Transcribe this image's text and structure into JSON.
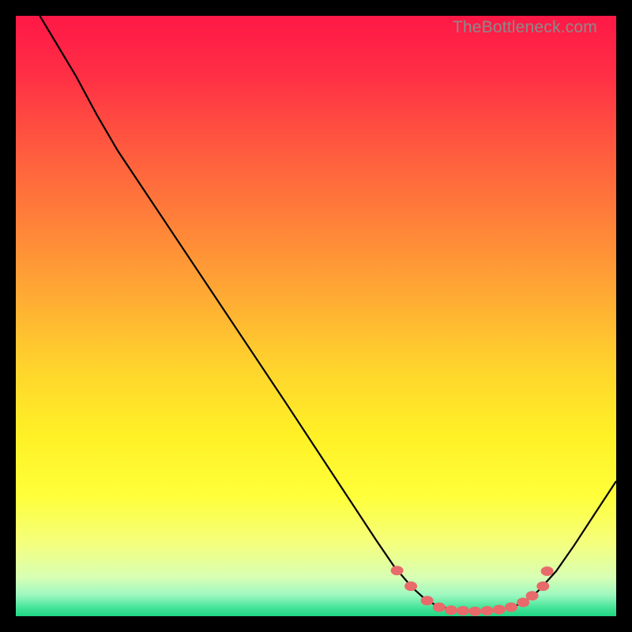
{
  "watermark": "TheBottleneck.com",
  "chart_data": {
    "type": "line",
    "title": "",
    "xlabel": "",
    "ylabel": "",
    "xlim": [
      0,
      100
    ],
    "ylim": [
      0,
      100
    ],
    "gradient_stops": [
      {
        "offset": 0.0,
        "color": "#ff1846"
      },
      {
        "offset": 0.1,
        "color": "#ff2f45"
      },
      {
        "offset": 0.22,
        "color": "#ff5a3f"
      },
      {
        "offset": 0.34,
        "color": "#ff8039"
      },
      {
        "offset": 0.46,
        "color": "#ffa834"
      },
      {
        "offset": 0.58,
        "color": "#ffd22d"
      },
      {
        "offset": 0.7,
        "color": "#fff126"
      },
      {
        "offset": 0.8,
        "color": "#ffff3a"
      },
      {
        "offset": 0.88,
        "color": "#f4ff7e"
      },
      {
        "offset": 0.935,
        "color": "#d8ffb4"
      },
      {
        "offset": 0.965,
        "color": "#9cf8c0"
      },
      {
        "offset": 0.985,
        "color": "#48e59a"
      },
      {
        "offset": 1.0,
        "color": "#1fd683"
      }
    ],
    "series": [
      {
        "name": "curve",
        "color": "#000000",
        "points": [
          {
            "x": 4.0,
            "y": 100.0
          },
          {
            "x": 7.0,
            "y": 95.0
          },
          {
            "x": 10.0,
            "y": 90.0
          },
          {
            "x": 13.5,
            "y": 83.5
          },
          {
            "x": 17.0,
            "y": 77.5
          },
          {
            "x": 25.0,
            "y": 65.5
          },
          {
            "x": 35.0,
            "y": 50.5
          },
          {
            "x": 45.0,
            "y": 35.5
          },
          {
            "x": 55.0,
            "y": 20.3
          },
          {
            "x": 60.0,
            "y": 12.7
          },
          {
            "x": 63.0,
            "y": 8.3
          },
          {
            "x": 66.0,
            "y": 4.8
          },
          {
            "x": 68.0,
            "y": 3.0
          },
          {
            "x": 70.0,
            "y": 1.8
          },
          {
            "x": 73.0,
            "y": 1.0
          },
          {
            "x": 77.0,
            "y": 0.8
          },
          {
            "x": 80.0,
            "y": 1.0
          },
          {
            "x": 83.0,
            "y": 1.6
          },
          {
            "x": 85.0,
            "y": 2.6
          },
          {
            "x": 87.0,
            "y": 4.2
          },
          {
            "x": 90.0,
            "y": 7.5
          },
          {
            "x": 93.0,
            "y": 11.8
          },
          {
            "x": 96.0,
            "y": 16.4
          },
          {
            "x": 100.0,
            "y": 22.5
          }
        ]
      },
      {
        "name": "markers",
        "color": "#e86a6a",
        "points": [
          {
            "x": 63.5,
            "y": 7.6
          },
          {
            "x": 65.8,
            "y": 5.0
          },
          {
            "x": 68.5,
            "y": 2.6
          },
          {
            "x": 70.5,
            "y": 1.5
          },
          {
            "x": 72.5,
            "y": 1.0
          },
          {
            "x": 74.5,
            "y": 0.9
          },
          {
            "x": 76.5,
            "y": 0.8
          },
          {
            "x": 78.5,
            "y": 0.9
          },
          {
            "x": 80.5,
            "y": 1.1
          },
          {
            "x": 82.5,
            "y": 1.5
          },
          {
            "x": 84.5,
            "y": 2.3
          },
          {
            "x": 86.0,
            "y": 3.4
          },
          {
            "x": 87.8,
            "y": 5.0
          },
          {
            "x": 88.5,
            "y": 7.5
          }
        ]
      }
    ]
  }
}
